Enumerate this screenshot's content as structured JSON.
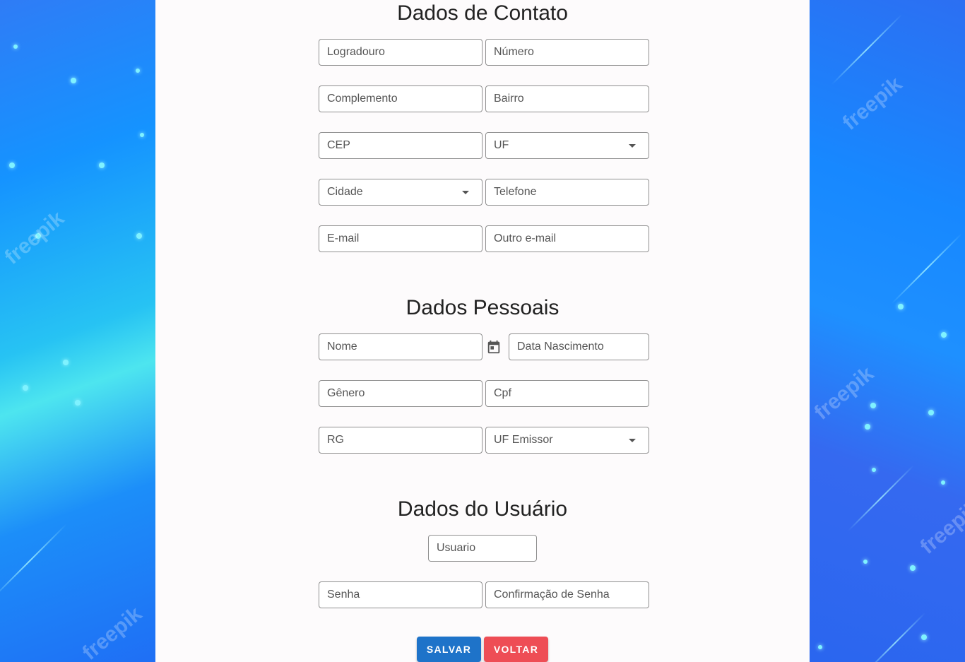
{
  "sections": {
    "contact": {
      "title": "Dados de Contato"
    },
    "personal": {
      "title": "Dados Pessoais"
    },
    "user": {
      "title": "Dados do Usuário"
    }
  },
  "fields": {
    "logradouro": "Logradouro",
    "numero": "Número",
    "complemento": "Complemento",
    "bairro": "Bairro",
    "cep": "CEP",
    "uf": "UF",
    "cidade": "Cidade",
    "telefone": "Telefone",
    "email": "E-mail",
    "outro_email": "Outro e-mail",
    "nome": "Nome",
    "data_nascimento": "Data Nascimento",
    "genero": "Gênero",
    "cpf": "Cpf",
    "rg": "RG",
    "uf_emissor": "UF Emissor",
    "usuario": "Usuario",
    "senha": "Senha",
    "confirmacao_senha": "Confirmação de Senha"
  },
  "buttons": {
    "save": "SALVAR",
    "back": "VOLTAR"
  },
  "background": {
    "watermark": "freepik"
  },
  "colors": {
    "save_button": "#1e73c9",
    "back_button": "#ee4d55",
    "panel": "#fdfbfc"
  }
}
